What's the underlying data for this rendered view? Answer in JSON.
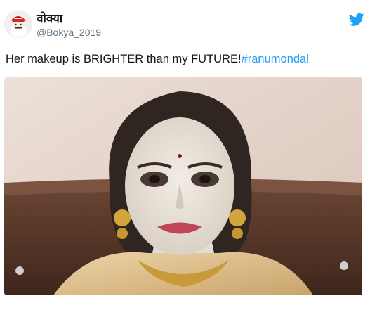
{
  "tweet": {
    "display_name": "वोक्या",
    "handle": "@Bokya_2019",
    "text": "Her makeup is BRIGHTER than my FUTURE!",
    "hashtag": "#ranumondal",
    "brand_icon": "twitter-bird-icon",
    "accent_color": "#1da1f2"
  }
}
